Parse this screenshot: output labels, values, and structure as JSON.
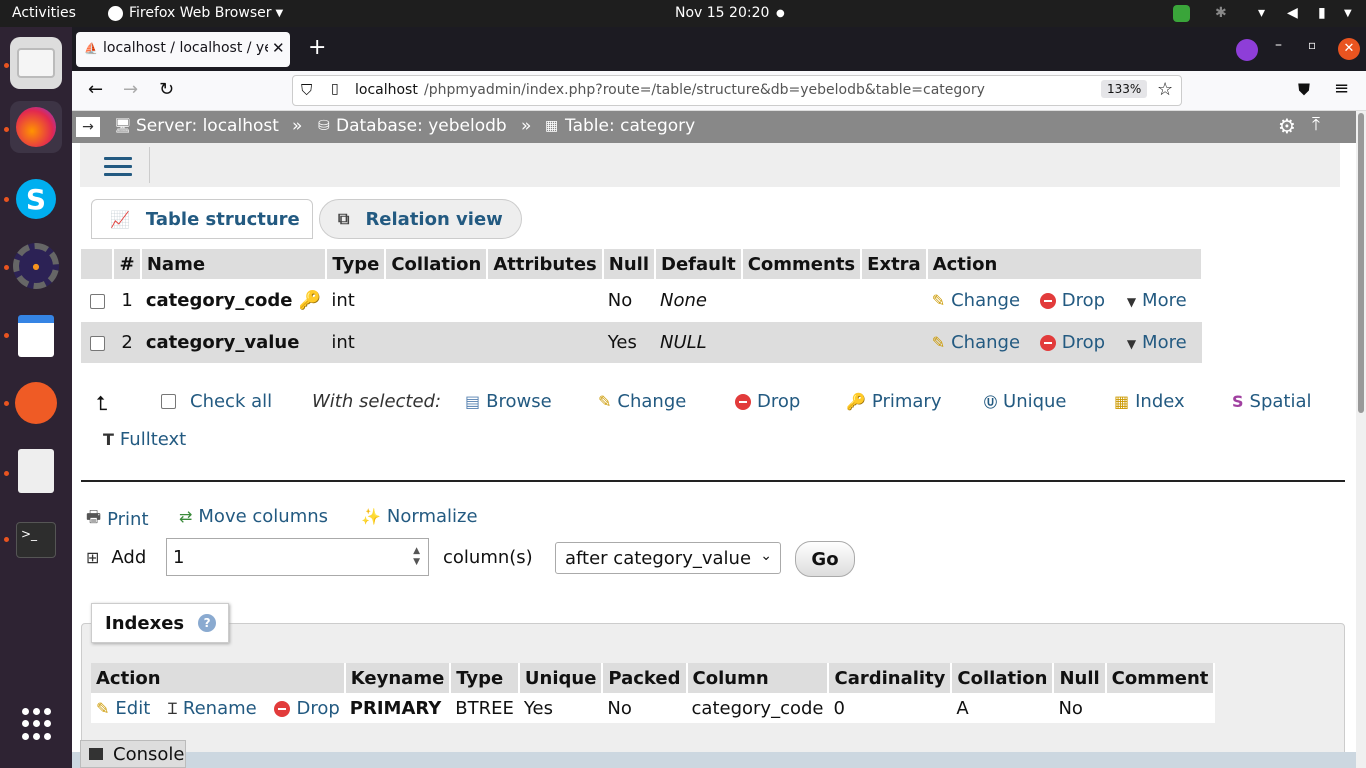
{
  "topbar": {
    "activities": "Activities",
    "app": "Firefox Web Browser",
    "clock": "Nov 15  20:20"
  },
  "tab": {
    "title": "localhost / localhost / yebelodb"
  },
  "url": {
    "host": "localhost",
    "path": "/phpmyadmin/index.php?route=/table/structure&db=yebelodb&table=category",
    "zoom": "133%"
  },
  "breadcrumb": {
    "server": "Server: localhost",
    "database": "Database: yebelodb",
    "table": "Table: category",
    "sep": "»"
  },
  "tabs": {
    "structure": "Table structure",
    "relation": "Relation view"
  },
  "columns_table": {
    "headers": [
      "#",
      "Name",
      "Type",
      "Collation",
      "Attributes",
      "Null",
      "Default",
      "Comments",
      "Extra",
      "Action"
    ],
    "rows": [
      {
        "num": "1",
        "name": "category_code",
        "type": "int",
        "null": "No",
        "default": "None"
      },
      {
        "num": "2",
        "name": "category_value",
        "type": "int",
        "null": "Yes",
        "default": "NULL"
      }
    ],
    "actions": {
      "change": "Change",
      "drop": "Drop",
      "more": "More"
    }
  },
  "bulk": {
    "check_all": "Check all",
    "with_selected": "With selected:",
    "browse": "Browse",
    "change": "Change",
    "drop": "Drop",
    "primary": "Primary",
    "unique": "Unique",
    "index": "Index",
    "spatial": "Spatial",
    "fulltext": "Fulltext"
  },
  "tools": {
    "print": "Print",
    "move_columns": "Move columns",
    "normalize": "Normalize"
  },
  "add": {
    "label": "Add",
    "value": "1",
    "unit": "column(s)",
    "position": "after category_value",
    "go": "Go"
  },
  "indexes": {
    "title": "Indexes",
    "headers": [
      "Action",
      "Keyname",
      "Type",
      "Unique",
      "Packed",
      "Column",
      "Cardinality",
      "Collation",
      "Null",
      "Comment"
    ],
    "row": {
      "edit": "Edit",
      "rename": "Rename",
      "drop": "Drop",
      "keyname": "PRIMARY",
      "type": "BTREE",
      "unique": "Yes",
      "packed": "No",
      "column": "category_code",
      "cardinality": "0",
      "collation": "A",
      "null": "No",
      "comment": ""
    }
  },
  "console": {
    "label": "Console"
  }
}
